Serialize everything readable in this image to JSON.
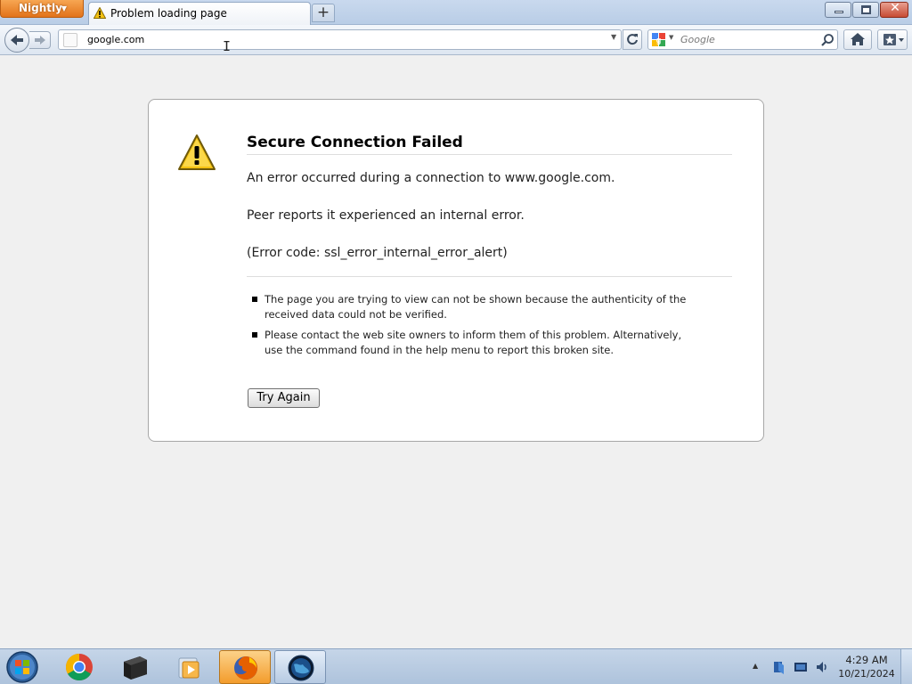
{
  "browser": {
    "app_menu_label": "Nightly",
    "tab_title": "Problem loading page",
    "url": "google.com",
    "search_placeholder": "Google"
  },
  "error": {
    "title": "Secure Connection Failed",
    "line1": "An error occurred during a connection to www.google.com.",
    "line2": "Peer reports it experienced an internal error.",
    "line3": "(Error code: ssl_error_internal_error_alert)",
    "bullets": [
      "The page you are trying to view can not be shown because the authenticity of the received data could not be verified.",
      "Please contact the web site owners to inform them of this problem. Alternatively, use the command found in the help menu to report this broken site."
    ],
    "try_again_label": "Try Again"
  },
  "taskbar": {
    "time": "4:29 AM",
    "date": "10/21/2024",
    "items": [
      "chrome-icon",
      "terminal-icon",
      "media-player-icon",
      "firefox-icon",
      "globe-app-icon"
    ]
  },
  "colors": {
    "accent_orange": "#e2731a",
    "warning_yellow": "#f4c211",
    "titlebar_blue": "#c9d9ee"
  }
}
